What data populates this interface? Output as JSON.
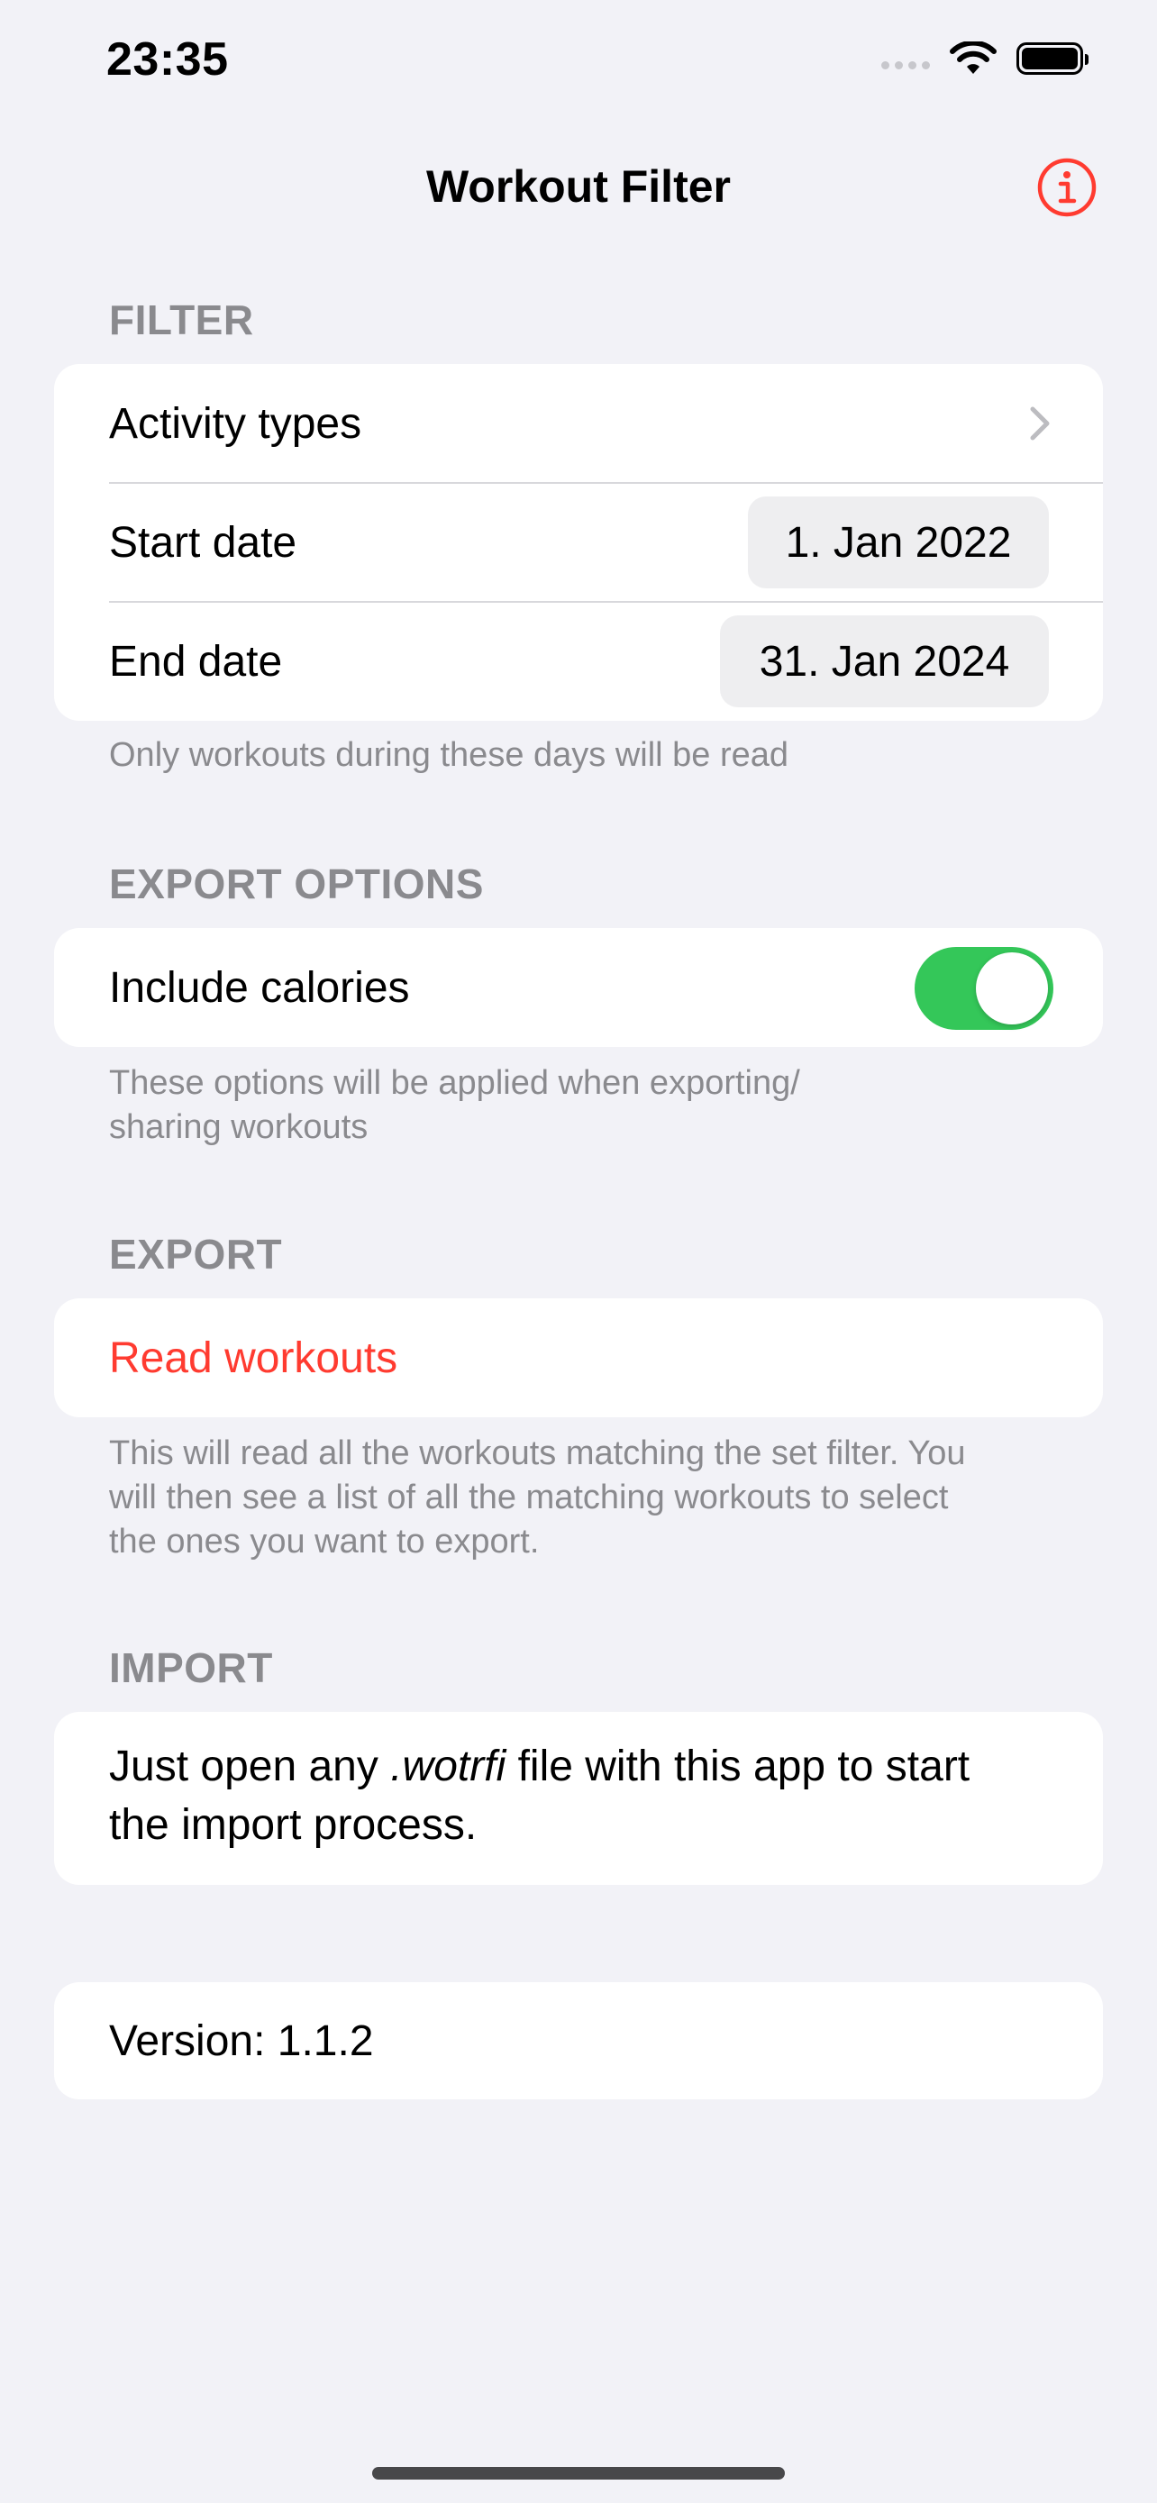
{
  "status_bar": {
    "time": "23:35"
  },
  "nav": {
    "title": "Workout Filter",
    "info_icon": "info-circle-icon"
  },
  "filter": {
    "header": "FILTER",
    "activity_types_label": "Activity types",
    "start_date_label": "Start date",
    "start_date_value": "1. Jan 2022",
    "end_date_label": "End date",
    "end_date_value": "31. Jan 2024",
    "footer": "Only workouts during these days will be read"
  },
  "export_options": {
    "header": "EXPORT OPTIONS",
    "include_calories_label": "Include calories",
    "include_calories_on": true,
    "footer_line1": "These options will be applied when exporting/",
    "footer_line2": "sharing workouts"
  },
  "export": {
    "header": "EXPORT",
    "read_workouts_label": "Read workouts",
    "footer_line1": "This will read all the workouts matching the set filter. You",
    "footer_line2": "will then see a list of all the matching workouts to select",
    "footer_line3": "the ones you want to export."
  },
  "import": {
    "header": "IMPORT",
    "text_before": "Just open any ",
    "text_italic": ".wotrfi",
    "text_after": " file with this app to start",
    "text_line2": "the import process."
  },
  "version": {
    "label": "Version: 1.1.2"
  },
  "colors": {
    "accent": "#ff3b30",
    "toggle_on": "#34c759",
    "background": "#f2f2f7",
    "secondary_text": "#8a8a8e"
  }
}
